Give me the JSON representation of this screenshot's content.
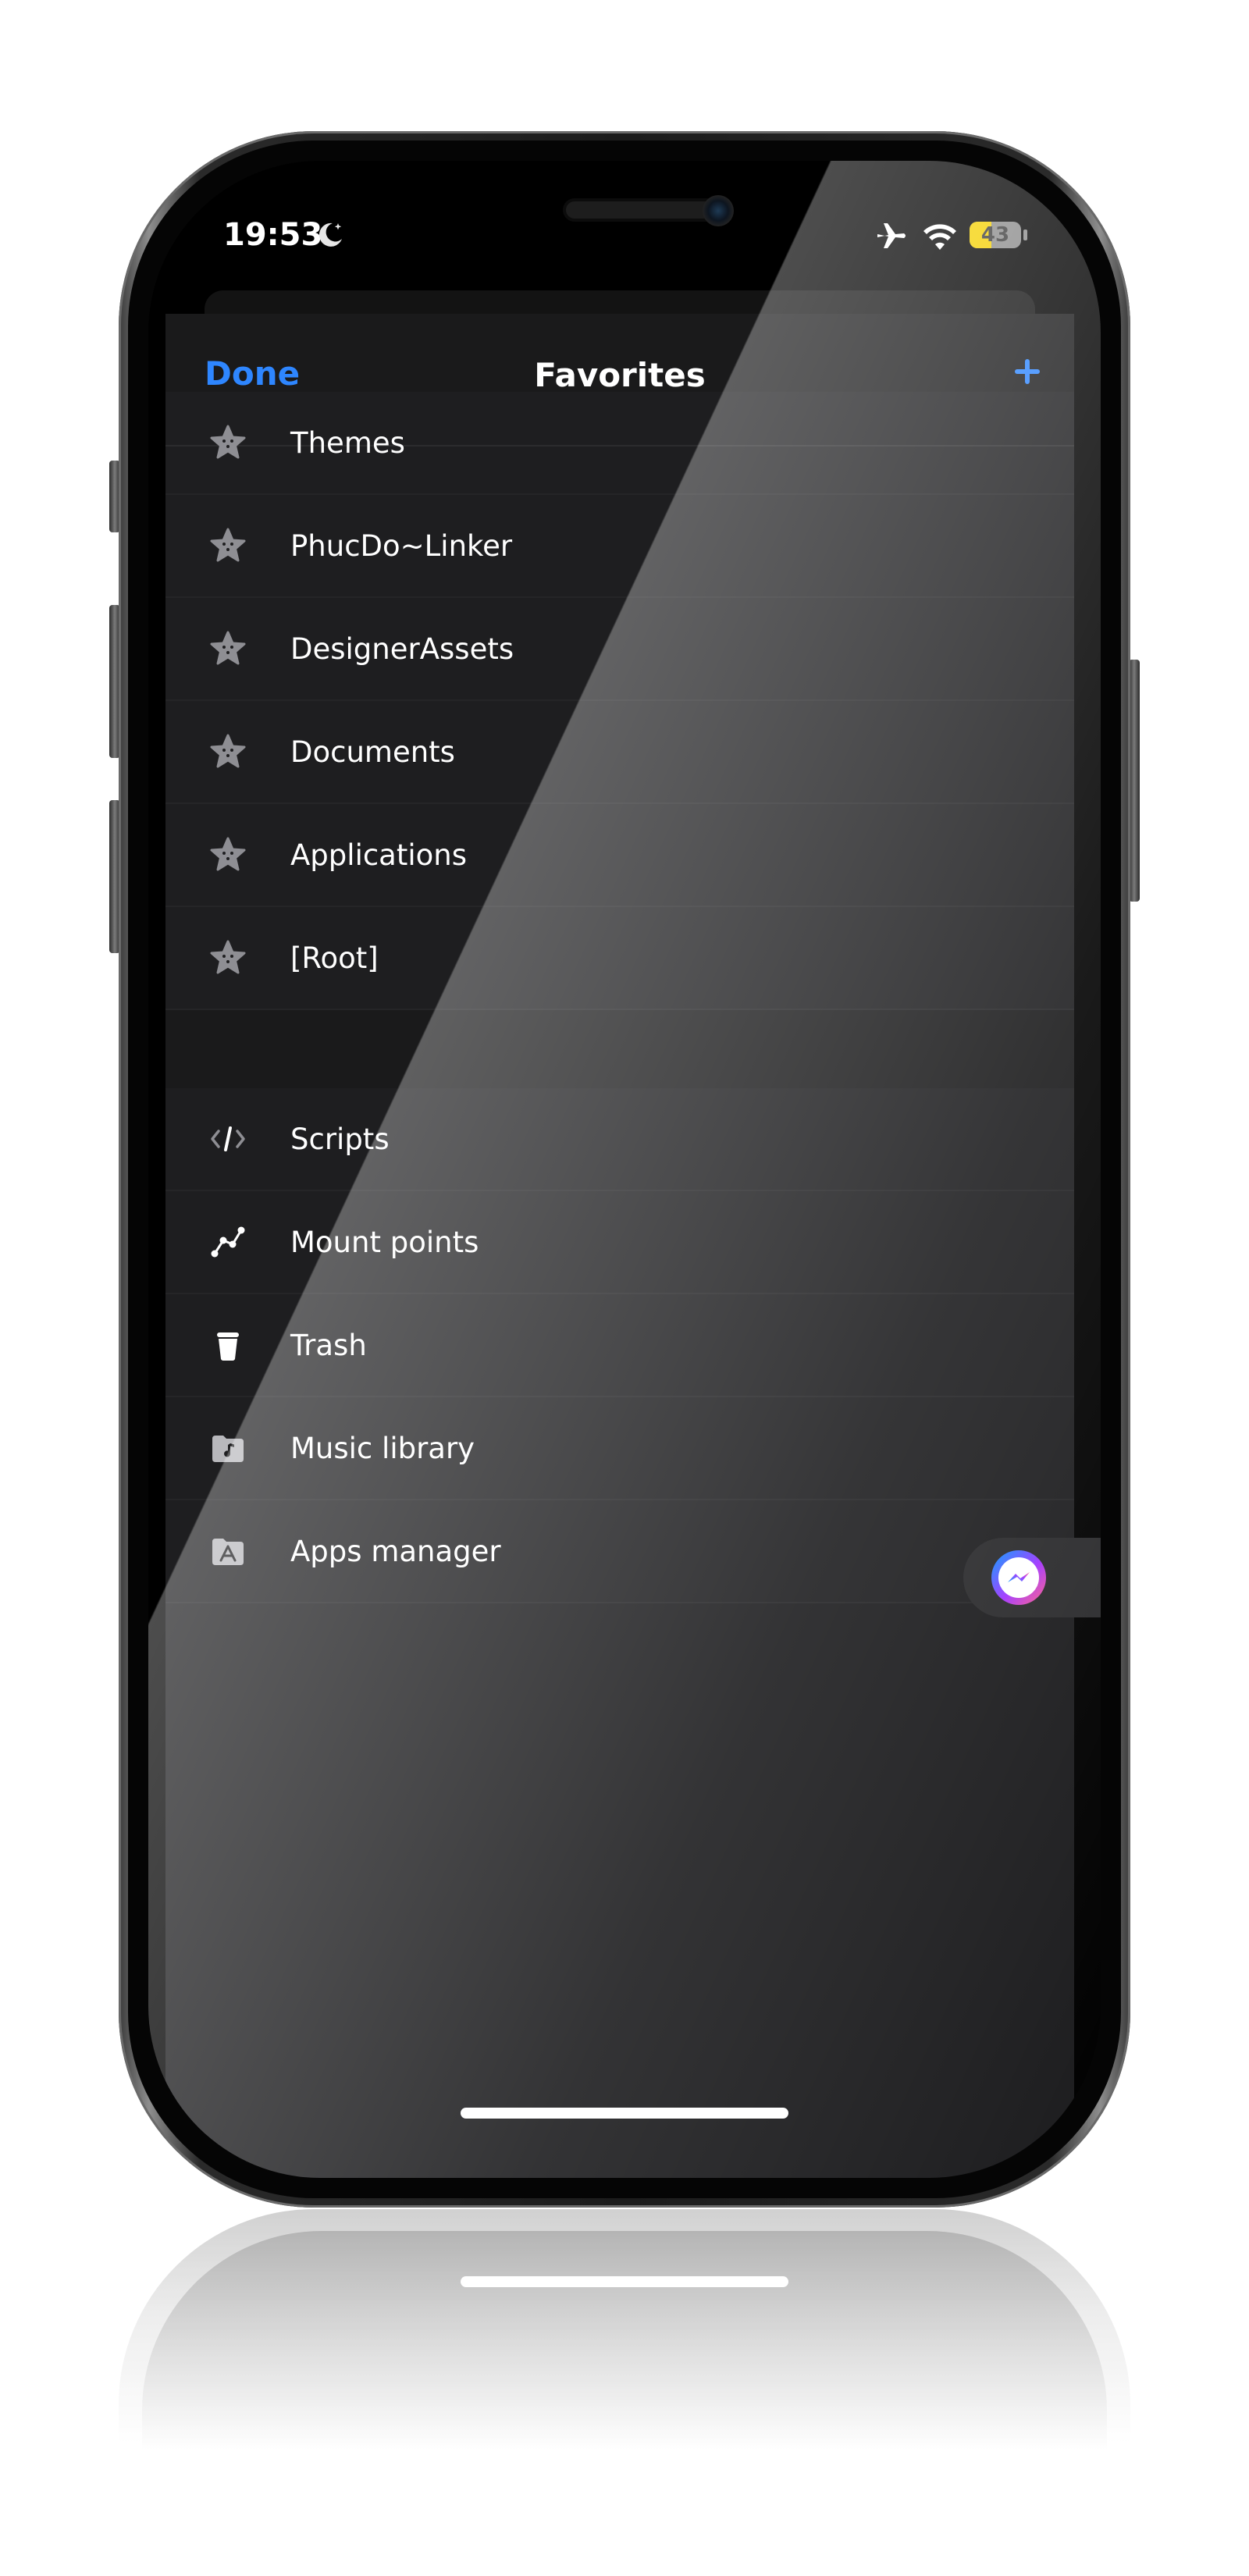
{
  "status_bar": {
    "time": "19:53",
    "battery_level": "43",
    "battery_fraction": 0.43,
    "icons": [
      "moon-icon",
      "airplane-icon",
      "wifi-icon",
      "battery-icon"
    ]
  },
  "nav": {
    "done_label": "Done",
    "title": "Favorites",
    "add_icon": "plus-icon"
  },
  "favorites": {
    "items": [
      {
        "label": "Themes",
        "icon": "favorite-star-icon"
      },
      {
        "label": "PhucDo~Linker",
        "icon": "favorite-star-icon"
      },
      {
        "label": "DesignerAssets",
        "icon": "favorite-star-icon"
      },
      {
        "label": "Documents",
        "icon": "favorite-star-icon"
      },
      {
        "label": "Applications",
        "icon": "favorite-star-icon"
      },
      {
        "label": "[Root]",
        "icon": "favorite-star-icon"
      }
    ]
  },
  "tools": {
    "items": [
      {
        "label": "Scripts",
        "icon": "code-icon"
      },
      {
        "label": "Mount points",
        "icon": "mount-points-icon"
      },
      {
        "label": "Trash",
        "icon": "trash-icon"
      },
      {
        "label": "Music library",
        "icon": "music-folder-icon"
      },
      {
        "label": "Apps manager",
        "icon": "apps-folder-icon"
      }
    ]
  },
  "floating": {
    "icon": "messenger-icon"
  },
  "colors": {
    "accent": "#2e86ff",
    "background": "#1c1c1e",
    "battery": "#f5d000"
  }
}
